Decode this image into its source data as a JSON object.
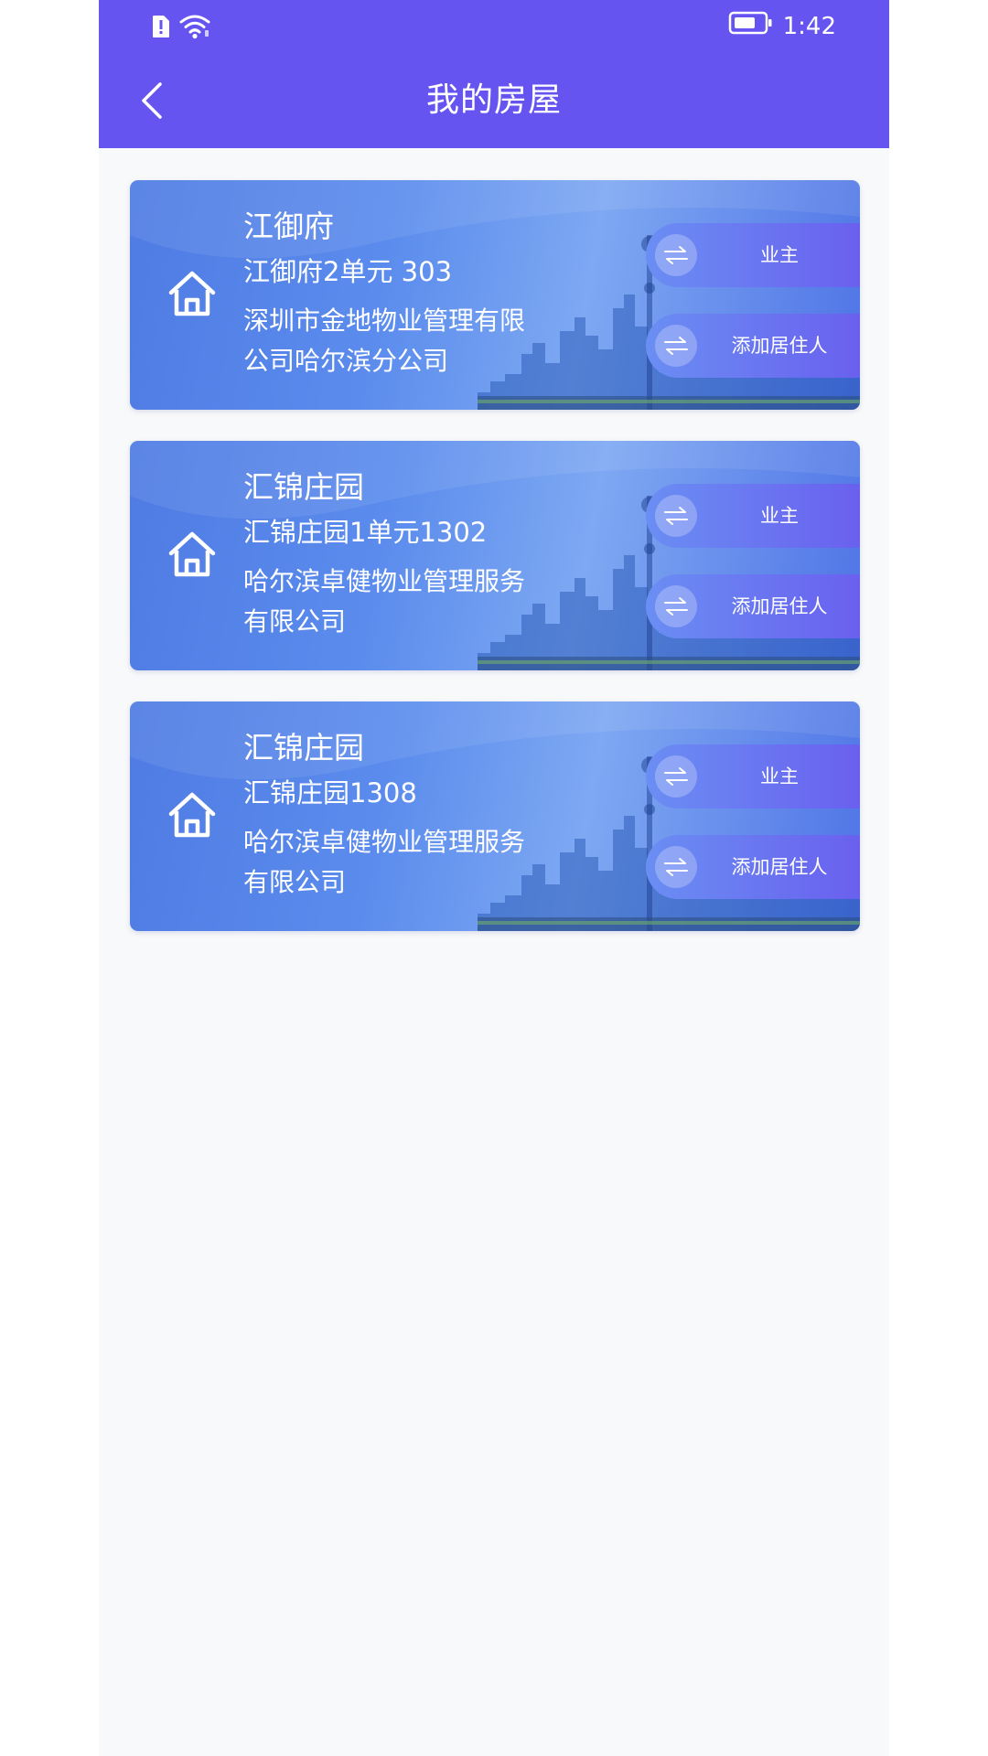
{
  "status_bar": {
    "time": "1:42",
    "icons": [
      "alert-icon",
      "wifi-icon",
      "battery-icon"
    ]
  },
  "header": {
    "title": "我的房屋",
    "back_icon": "chevron-left-icon"
  },
  "houses": [
    {
      "name": "江御府",
      "unit": "江御府2单元 303",
      "company_line1": "深圳市金地物业管理有限",
      "company_line2": "公司哈尔滨分公司",
      "role_label": "业主",
      "add_label": "添加居住人"
    },
    {
      "name": "汇锦庄园",
      "unit": "汇锦庄园1单元1302",
      "company_line1": "哈尔滨卓健物业管理服务",
      "company_line2": "有限公司",
      "role_label": "业主",
      "add_label": "添加居住人"
    },
    {
      "name": "汇锦庄园",
      "unit": "汇锦庄园1308",
      "company_line1": "哈尔滨卓健物业管理服务",
      "company_line2": "有限公司",
      "role_label": "业主",
      "add_label": "添加居住人"
    }
  ],
  "colors": {
    "primary": "#6654f1",
    "card_blue": "#5b8ced",
    "background": "#f8f9fa"
  }
}
